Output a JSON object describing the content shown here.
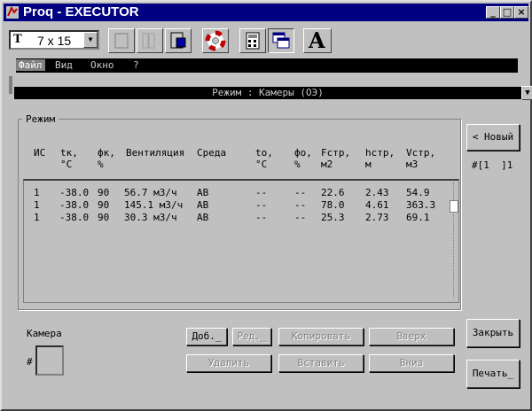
{
  "window": {
    "title": "Proq - EXECUTOR",
    "controls": [
      "_",
      "□",
      "×"
    ]
  },
  "toolbar": {
    "font_size": "7 x 15",
    "font_icon_text": "T",
    "bigA": "A"
  },
  "menu": [
    "Файл",
    "Вид",
    "Окно",
    "?"
  ],
  "child_title": "Режим : Камеры (ОЭ)",
  "group": {
    "legend": "Режим",
    "headers": [
      "ИС",
      "tк,\n°C",
      "фк,\n%",
      "Вентиляция",
      "Среда",
      "tо,\n°C",
      "фо,\n%",
      "Fстр,\nм2",
      "hстр,\nм",
      "Vстр,\nм3"
    ],
    "rows": [
      [
        "1",
        "-38.0",
        "90",
        "56.7 м3/ч",
        "АВ",
        "--",
        "--",
        "22.6",
        "2.43",
        "54.9"
      ],
      [
        "1",
        "-38.0",
        "90",
        "145.1 м3/ч",
        "АВ",
        "--",
        "--",
        "78.0",
        "4.61",
        "363.3"
      ],
      [
        "1",
        "-38.0",
        "90",
        "30.3 м3/ч",
        "АВ",
        "--",
        "--",
        "25.3",
        "2.73",
        "69.1"
      ]
    ]
  },
  "right": {
    "new_button": "< Новый",
    "record_indicator": "#[1  ]1",
    "close_button": "Закрыть",
    "print_button": "Печать_"
  },
  "bottom": {
    "quantity_legend": "Камера",
    "hash": "#",
    "buttons": {
      "add": "Доб._",
      "edit": "Ред._",
      "copy": "Копировать",
      "up": "Вверх",
      "delete": "Удалить",
      "insert": "Вставить",
      "down": "Вниз"
    }
  }
}
